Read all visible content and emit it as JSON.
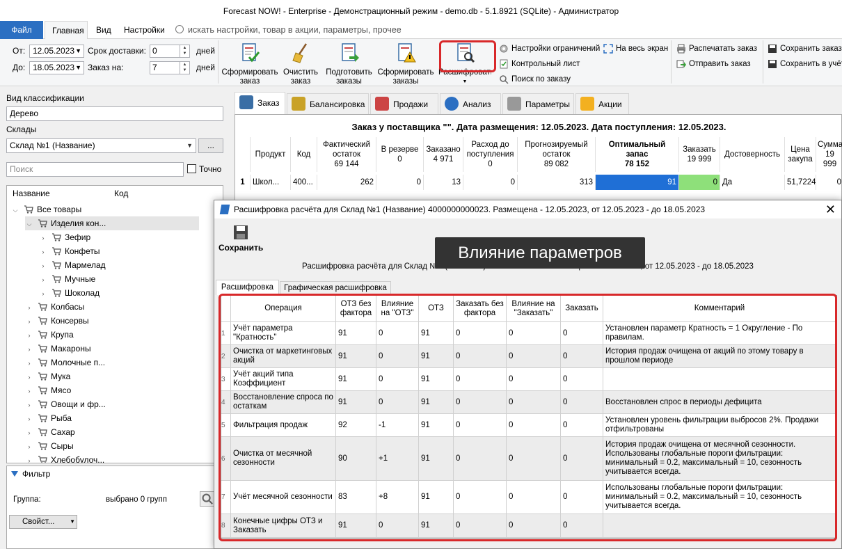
{
  "window_title": "Forecast NOW! - Enterprise - Демонстрационный режим - demo.db - 5.1.8921 (SQLite) - Администратор",
  "ribbon_tabs": {
    "file": "Файл",
    "home": "Главная",
    "view": "Вид",
    "settings": "Настройки"
  },
  "search_placeholder": "искать настройки, товар в акции, параметры, прочее",
  "params": {
    "from_label": "От:",
    "from": "12.05.2023",
    "to_label": "До:",
    "to": "18.05.2023",
    "delivery_label": "Срок доставки:",
    "delivery": "0",
    "delivery_unit": "дней",
    "order_for_label": "Заказ на:",
    "order_for": "7",
    "order_unit": "дней"
  },
  "ribbon_buttons": {
    "form_order": "Сформировать заказ",
    "clear_order": "Очистить заказ",
    "prepare_orders": "Подготовить заказы",
    "form_orders": "Сформировать заказы",
    "decode": "Расшифровать"
  },
  "ribbon_small": {
    "limits": "Настройки ограничений",
    "checklist": "Контрольный лист",
    "search_order": "Поиск по заказу",
    "fullscreen": "На весь экран",
    "print_order": "Распечатать заказ",
    "send_order": "Отправить заказ",
    "save_order": "Сохранить заказ",
    "save_to_account": "Сохранить в учёт"
  },
  "left": {
    "class_label": "Вид классификации",
    "class_value": "Дерево",
    "warehouses_label": "Склады",
    "warehouse_value": "Склад №1 (Название)",
    "browse": "...",
    "search_placeholder": "Поиск",
    "exact": "Точно",
    "col_name": "Название",
    "col_code": "Код",
    "tree": [
      "Все товары",
      "Изделия кон...",
      "Зефир",
      "Конфеты",
      "Мармелад",
      "Мучные",
      "Шоколад",
      "Колбасы",
      "Консервы",
      "Крупа",
      "Макароны",
      "Молочные п...",
      "Мука",
      "Мясо",
      "Овощи и фр...",
      "Рыба",
      "Сахар",
      "Сыры",
      "Хлебобулоч..."
    ],
    "filter": "Фильтр",
    "group_label": "Группа:",
    "group_value": "выбрано 0 групп",
    "props": "Свойст..."
  },
  "main_tabs": [
    "Заказ",
    "Балансировка",
    "Продажи",
    "Анализ",
    "Параметры",
    "Акции"
  ],
  "order_header": "Заказ у поставщика \"\". Дата размещения: 12.05.2023. Дата поступления: 12.05.2023.",
  "grid": {
    "headers": [
      {
        "l1": "",
        "l2": ""
      },
      {
        "l1": "Продукт",
        "l2": ""
      },
      {
        "l1": "Код",
        "l2": ""
      },
      {
        "l1": "Фактический остаток",
        "l2": "69 144"
      },
      {
        "l1": "В резерве",
        "l2": "0"
      },
      {
        "l1": "Заказано",
        "l2": "4 971"
      },
      {
        "l1": "Расход до поступления",
        "l2": "0"
      },
      {
        "l1": "Прогнозируемый остаток",
        "l2": "89 082"
      },
      {
        "l1": "Оптимальный запас",
        "l2": "78 152"
      },
      {
        "l1": "Заказать",
        "l2": "19 999"
      },
      {
        "l1": "Достоверность",
        "l2": ""
      },
      {
        "l1": "Цена закупа",
        "l2": ""
      },
      {
        "l1": "Сумма",
        "l2": "19 999"
      }
    ],
    "row": [
      "1",
      "Школ...",
      "400...",
      "262",
      "0",
      "13",
      "0",
      "313",
      "91",
      "0",
      "Да",
      "51,7224",
      "0"
    ]
  },
  "dialog": {
    "title": "Расшифровка расчёта для Склад №1 (Название) 4000000000023. Размещена - 12.05.2023, от 12.05.2023 - до 18.05.2023",
    "save": "Сохранить",
    "tooltip": "Влияние параметров",
    "subtitle": "Расшифровка расчёта для Склад №1 (Название) 4000000000023. Размещена - 12.05.2023, от 12.05.2023 - до 18.05.2023",
    "tab1": "Расшифровка",
    "tab2": "Графическая расшифровка",
    "headers": [
      "Операция",
      "ОТЗ без фактора",
      "Влияние на \"ОТЗ\"",
      "ОТЗ",
      "Заказать без фактора",
      "Влияние на \"Заказать\"",
      "Заказать",
      "Комментарий"
    ],
    "rows": [
      {
        "n": "1",
        "op": "Учёт параметра \"Кратность\"",
        "otz0": "91",
        "inf": "0",
        "otz": "91",
        "ord0": "0",
        "infz": "0",
        "ord": "0",
        "c": "Установлен параметр Кратность = 1 Округление - По правилам."
      },
      {
        "n": "2",
        "op": "Очистка от маркетинговых акций",
        "otz0": "91",
        "inf": "0",
        "otz": "91",
        "ord0": "0",
        "infz": "0",
        "ord": "0",
        "c": "История продаж очищена от акций по этому товару в прошлом периоде"
      },
      {
        "n": "3",
        "op": "Учёт акций типа Коэффициент",
        "otz0": "91",
        "inf": "0",
        "otz": "91",
        "ord0": "0",
        "infz": "0",
        "ord": "0",
        "c": ""
      },
      {
        "n": "4",
        "op": "Восстановление спроса по остаткам",
        "otz0": "91",
        "inf": "0",
        "otz": "91",
        "ord0": "0",
        "infz": "0",
        "ord": "0",
        "c": "Восстановлен спрос в периоды дефицита"
      },
      {
        "n": "5",
        "op": "Фильтрация продаж",
        "otz0": "92",
        "inf": "-1",
        "otz": "91",
        "ord0": "0",
        "infz": "0",
        "ord": "0",
        "c": "Установлен уровень фильтрации выбросов 2%. Продажи отфильтрованы"
      },
      {
        "n": "6",
        "op": "Очистка от месячной сезонности",
        "otz0": "90",
        "inf": "+1",
        "otz": "91",
        "ord0": "0",
        "infz": "0",
        "ord": "0",
        "c": "История продаж очищена от месячной сезонности. Использованы глобальные пороги фильтрации: минимальный = 0.2, максимальный = 10, сезонность учитывается всегда."
      },
      {
        "n": "7",
        "op": "Учёт месячной сезонности",
        "otz0": "83",
        "inf": "+8",
        "otz": "91",
        "ord0": "0",
        "infz": "0",
        "ord": "0",
        "c": "Использованы глобальные пороги фильтрации: минимальный = 0.2, максимальный = 10, сезонность учитывается всегда."
      },
      {
        "n": "8",
        "op": "Конечные цифры ОТЗ и Заказать",
        "otz0": "91",
        "inf": "0",
        "otz": "91",
        "ord0": "0",
        "infz": "0",
        "ord": "0",
        "c": ""
      }
    ]
  }
}
